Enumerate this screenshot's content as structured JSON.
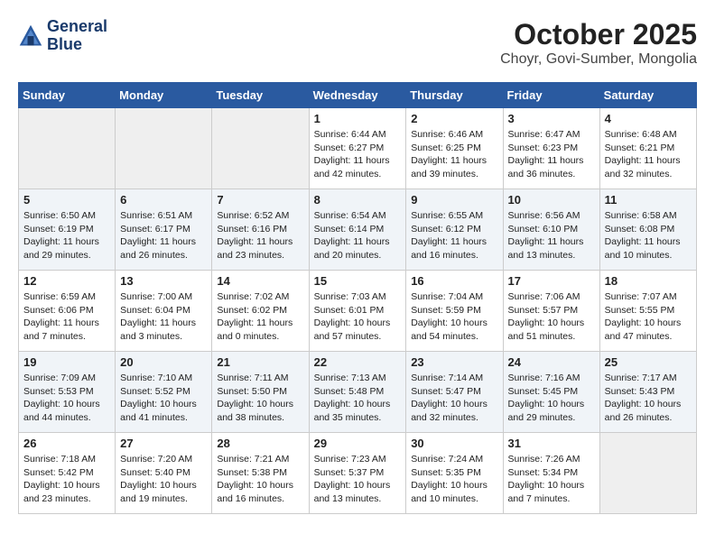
{
  "header": {
    "logo_line1": "General",
    "logo_line2": "Blue",
    "month": "October 2025",
    "location": "Choyr, Govi-Sumber, Mongolia"
  },
  "days_of_week": [
    "Sunday",
    "Monday",
    "Tuesday",
    "Wednesday",
    "Thursday",
    "Friday",
    "Saturday"
  ],
  "weeks": [
    [
      {
        "day": "",
        "info": ""
      },
      {
        "day": "",
        "info": ""
      },
      {
        "day": "",
        "info": ""
      },
      {
        "day": "1",
        "info": "Sunrise: 6:44 AM\nSunset: 6:27 PM\nDaylight: 11 hours\nand 42 minutes."
      },
      {
        "day": "2",
        "info": "Sunrise: 6:46 AM\nSunset: 6:25 PM\nDaylight: 11 hours\nand 39 minutes."
      },
      {
        "day": "3",
        "info": "Sunrise: 6:47 AM\nSunset: 6:23 PM\nDaylight: 11 hours\nand 36 minutes."
      },
      {
        "day": "4",
        "info": "Sunrise: 6:48 AM\nSunset: 6:21 PM\nDaylight: 11 hours\nand 32 minutes."
      }
    ],
    [
      {
        "day": "5",
        "info": "Sunrise: 6:50 AM\nSunset: 6:19 PM\nDaylight: 11 hours\nand 29 minutes."
      },
      {
        "day": "6",
        "info": "Sunrise: 6:51 AM\nSunset: 6:17 PM\nDaylight: 11 hours\nand 26 minutes."
      },
      {
        "day": "7",
        "info": "Sunrise: 6:52 AM\nSunset: 6:16 PM\nDaylight: 11 hours\nand 23 minutes."
      },
      {
        "day": "8",
        "info": "Sunrise: 6:54 AM\nSunset: 6:14 PM\nDaylight: 11 hours\nand 20 minutes."
      },
      {
        "day": "9",
        "info": "Sunrise: 6:55 AM\nSunset: 6:12 PM\nDaylight: 11 hours\nand 16 minutes."
      },
      {
        "day": "10",
        "info": "Sunrise: 6:56 AM\nSunset: 6:10 PM\nDaylight: 11 hours\nand 13 minutes."
      },
      {
        "day": "11",
        "info": "Sunrise: 6:58 AM\nSunset: 6:08 PM\nDaylight: 11 hours\nand 10 minutes."
      }
    ],
    [
      {
        "day": "12",
        "info": "Sunrise: 6:59 AM\nSunset: 6:06 PM\nDaylight: 11 hours\nand 7 minutes."
      },
      {
        "day": "13",
        "info": "Sunrise: 7:00 AM\nSunset: 6:04 PM\nDaylight: 11 hours\nand 3 minutes."
      },
      {
        "day": "14",
        "info": "Sunrise: 7:02 AM\nSunset: 6:02 PM\nDaylight: 11 hours\nand 0 minutes."
      },
      {
        "day": "15",
        "info": "Sunrise: 7:03 AM\nSunset: 6:01 PM\nDaylight: 10 hours\nand 57 minutes."
      },
      {
        "day": "16",
        "info": "Sunrise: 7:04 AM\nSunset: 5:59 PM\nDaylight: 10 hours\nand 54 minutes."
      },
      {
        "day": "17",
        "info": "Sunrise: 7:06 AM\nSunset: 5:57 PM\nDaylight: 10 hours\nand 51 minutes."
      },
      {
        "day": "18",
        "info": "Sunrise: 7:07 AM\nSunset: 5:55 PM\nDaylight: 10 hours\nand 47 minutes."
      }
    ],
    [
      {
        "day": "19",
        "info": "Sunrise: 7:09 AM\nSunset: 5:53 PM\nDaylight: 10 hours\nand 44 minutes."
      },
      {
        "day": "20",
        "info": "Sunrise: 7:10 AM\nSunset: 5:52 PM\nDaylight: 10 hours\nand 41 minutes."
      },
      {
        "day": "21",
        "info": "Sunrise: 7:11 AM\nSunset: 5:50 PM\nDaylight: 10 hours\nand 38 minutes."
      },
      {
        "day": "22",
        "info": "Sunrise: 7:13 AM\nSunset: 5:48 PM\nDaylight: 10 hours\nand 35 minutes."
      },
      {
        "day": "23",
        "info": "Sunrise: 7:14 AM\nSunset: 5:47 PM\nDaylight: 10 hours\nand 32 minutes."
      },
      {
        "day": "24",
        "info": "Sunrise: 7:16 AM\nSunset: 5:45 PM\nDaylight: 10 hours\nand 29 minutes."
      },
      {
        "day": "25",
        "info": "Sunrise: 7:17 AM\nSunset: 5:43 PM\nDaylight: 10 hours\nand 26 minutes."
      }
    ],
    [
      {
        "day": "26",
        "info": "Sunrise: 7:18 AM\nSunset: 5:42 PM\nDaylight: 10 hours\nand 23 minutes."
      },
      {
        "day": "27",
        "info": "Sunrise: 7:20 AM\nSunset: 5:40 PM\nDaylight: 10 hours\nand 19 minutes."
      },
      {
        "day": "28",
        "info": "Sunrise: 7:21 AM\nSunset: 5:38 PM\nDaylight: 10 hours\nand 16 minutes."
      },
      {
        "day": "29",
        "info": "Sunrise: 7:23 AM\nSunset: 5:37 PM\nDaylight: 10 hours\nand 13 minutes."
      },
      {
        "day": "30",
        "info": "Sunrise: 7:24 AM\nSunset: 5:35 PM\nDaylight: 10 hours\nand 10 minutes."
      },
      {
        "day": "31",
        "info": "Sunrise: 7:26 AM\nSunset: 5:34 PM\nDaylight: 10 hours\nand 7 minutes."
      },
      {
        "day": "",
        "info": ""
      }
    ]
  ]
}
